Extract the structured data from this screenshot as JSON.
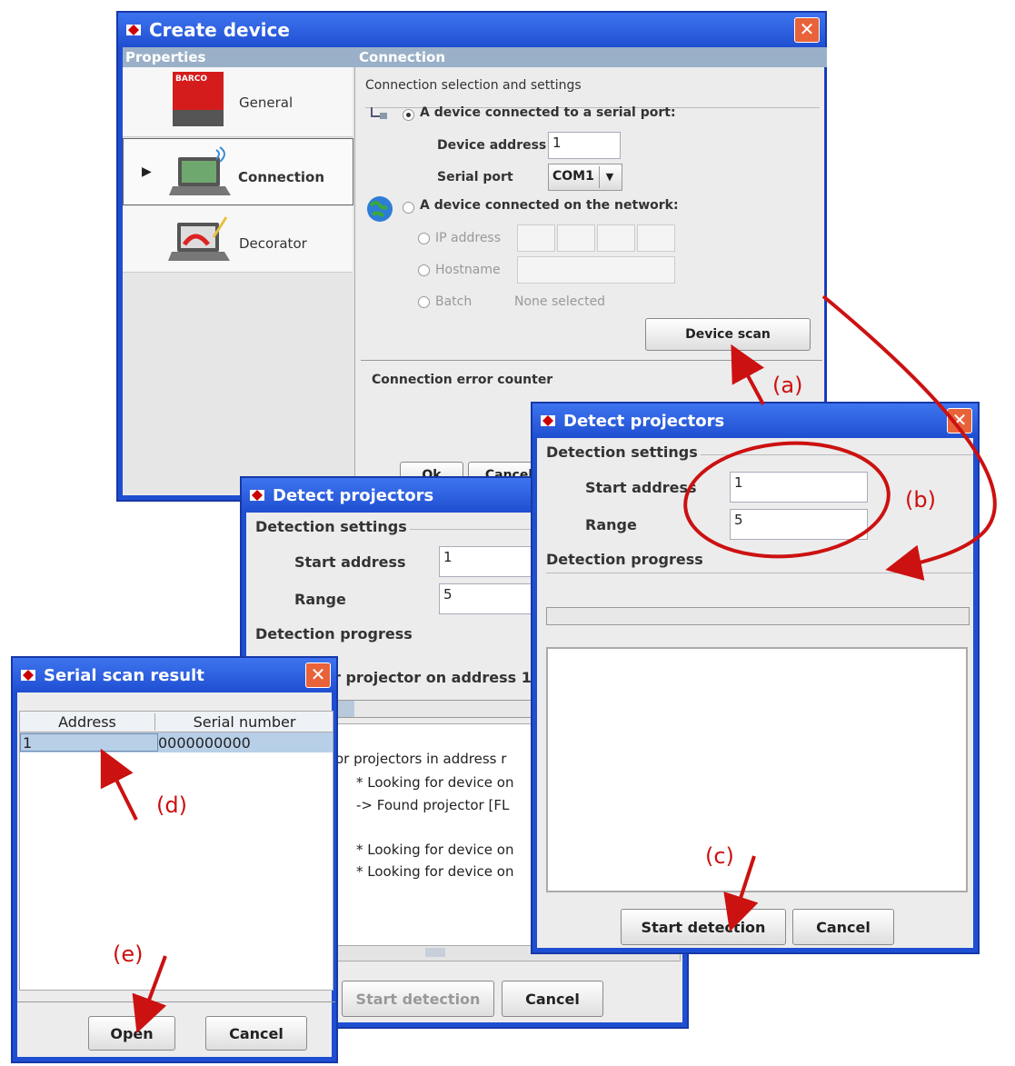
{
  "create_device": {
    "title": "Create device",
    "properties_header": "Properties",
    "connection_header": "Connection",
    "properties": [
      {
        "label": "General"
      },
      {
        "label": "Connection"
      },
      {
        "label": "Decorator"
      }
    ],
    "brand_logo": "BARCO",
    "conn_section": "Connection selection and settings",
    "serial_option": "A device connected to a serial port:",
    "device_address_label": "Device address",
    "device_address_value": "1",
    "serial_port_label": "Serial port",
    "serial_port_value": "COM1",
    "network_option": "A device connected on the network:",
    "ip_label": "IP address",
    "hostname_label": "Hostname",
    "batch_label": "Batch",
    "batch_value": "None selected",
    "device_scan_button": "Device scan",
    "error_counter": "Connection error counter",
    "ok_partial": "Ok",
    "cancel_partial": "Cancel"
  },
  "detect_back": {
    "title": "Detect projectors",
    "settings_header": "Detection settings",
    "start_address_label": "Start address",
    "start_address_value": "1",
    "range_label": "Range",
    "range_value": "5",
    "progress_header": "Detection progress",
    "status_text": "r projector on address 1",
    "log_lines": [
      "or projectors in address r",
      "* Looking for device on",
      "-> Found projector [FL",
      "",
      "* Looking for device on",
      "* Looking for device on"
    ],
    "start_button": "Start detection",
    "cancel_button": "Cancel"
  },
  "detect_front": {
    "title": "Detect projectors",
    "settings_header": "Detection settings",
    "start_address_label": "Start address",
    "start_address_value": "1",
    "range_label": "Range",
    "range_value": "5",
    "progress_header": "Detection progress",
    "start_button": "Start detection",
    "cancel_button": "Cancel"
  },
  "serial_result": {
    "title": "Serial scan result",
    "columns": [
      "Address",
      "Serial number"
    ],
    "rows": [
      [
        "1",
        "0000000000"
      ]
    ],
    "open_button": "Open",
    "cancel_button": "Cancel"
  },
  "annotations": [
    "(a)",
    "(b)",
    "(c)",
    "(d)",
    "(e)"
  ],
  "colors": {
    "annotation": "#cc1111",
    "titlebar": "#1f4fd1",
    "close": "#e8623a"
  }
}
